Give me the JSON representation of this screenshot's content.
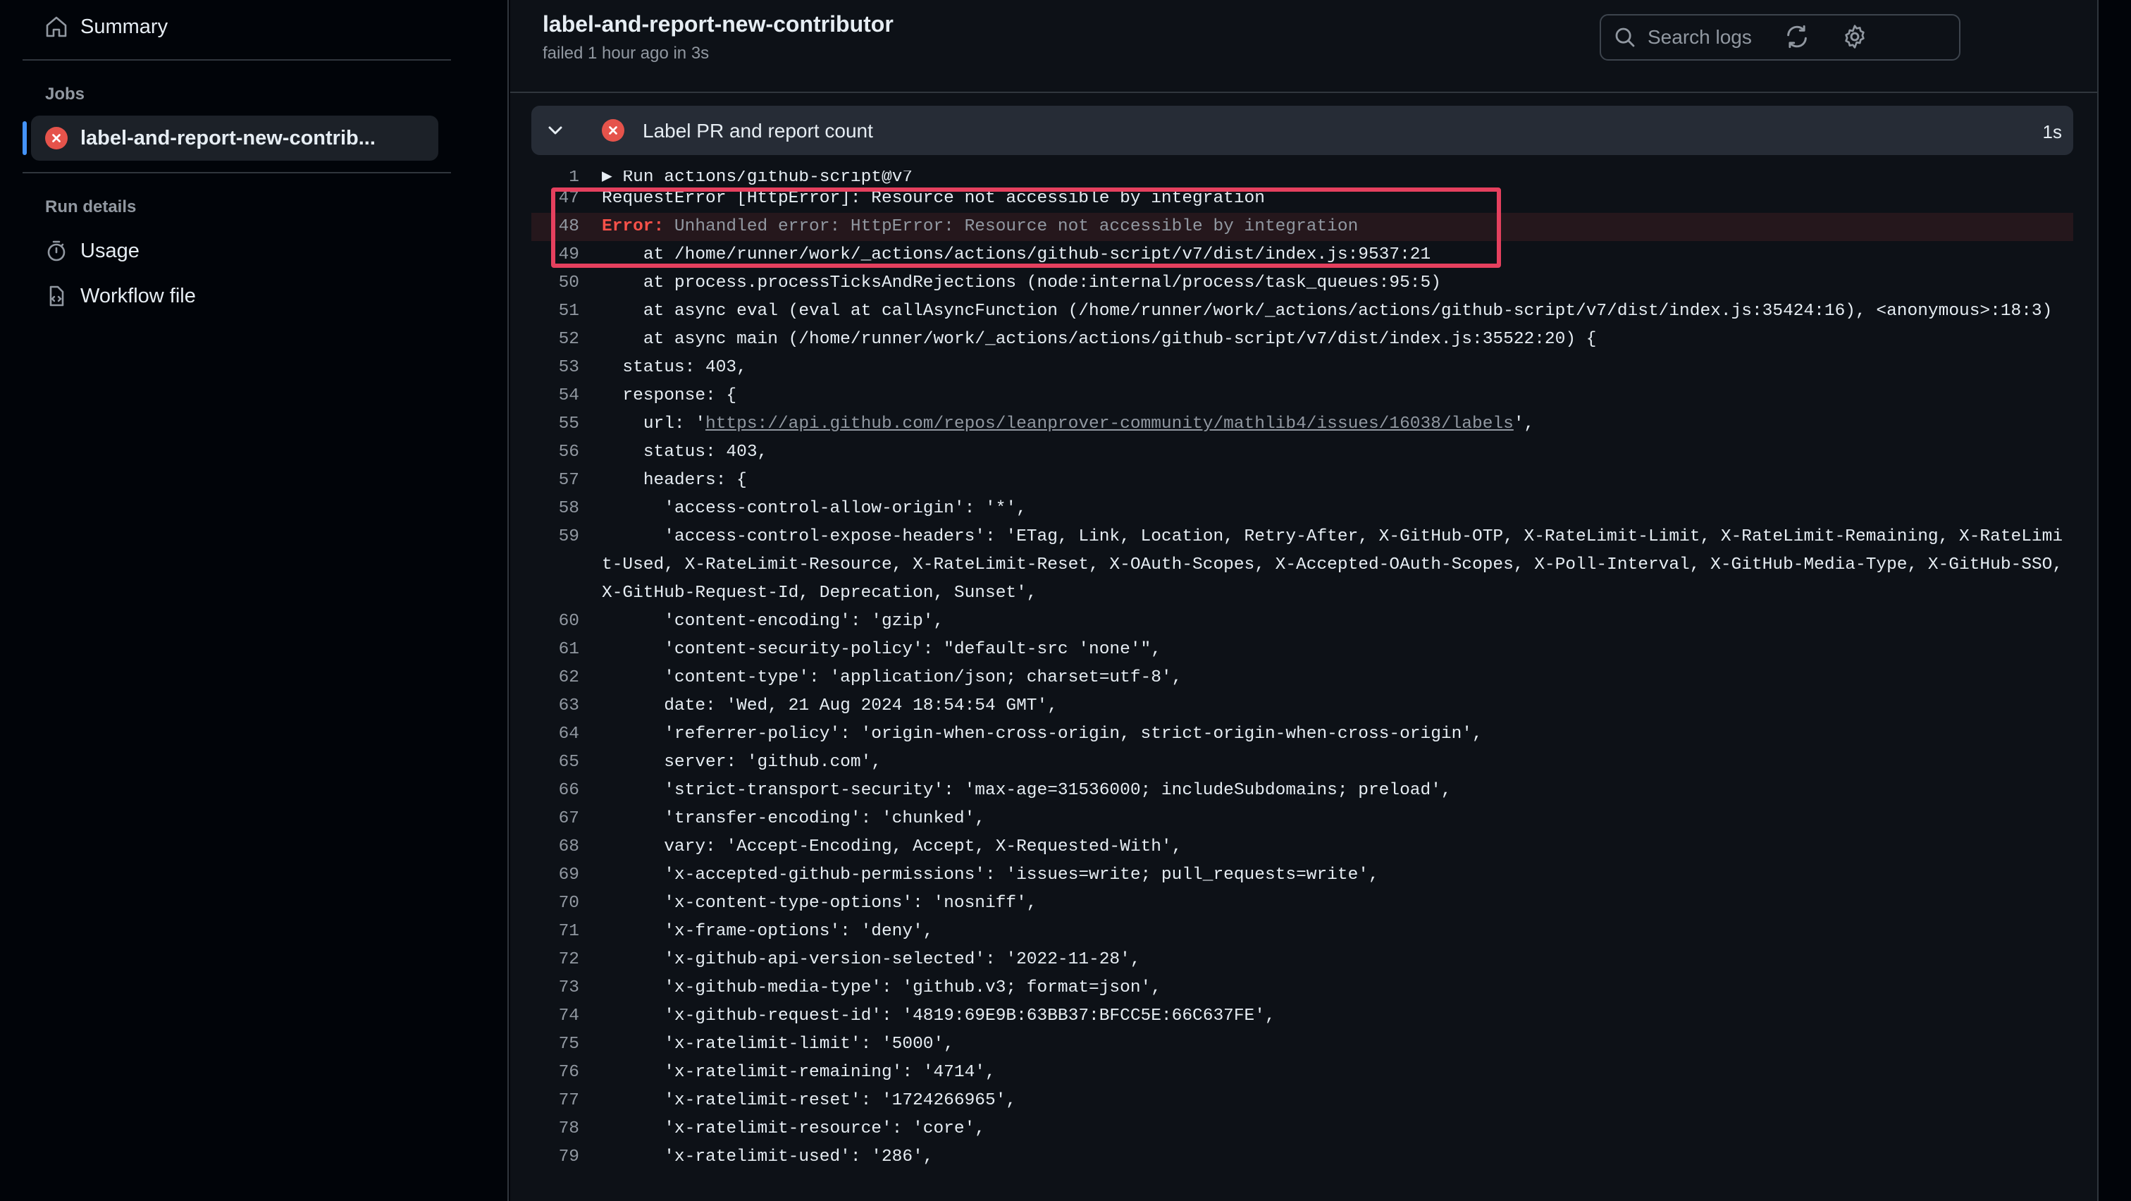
{
  "sidebar": {
    "summary_label": "Summary",
    "jobs_heading": "Jobs",
    "job_label": "label-and-report-new-contrib...",
    "run_details_heading": "Run details",
    "usage_label": "Usage",
    "workflow_file_label": "Workflow file"
  },
  "header": {
    "title": "label-and-report-new-contributor",
    "subtitle": "failed 1 hour ago in 3s",
    "search_placeholder": "Search logs"
  },
  "step": {
    "name": "Label PR and report count",
    "duration": "1s"
  },
  "log": {
    "l1_num": "1",
    "l1_text": "Run actions/github-script@v7",
    "l47_num": "47",
    "l47_text": "RequestError [HttpError]: Resource not accessible by integration",
    "l48_num": "48",
    "l48_kw": "Error:",
    "l48_msg": " Unhandled error: HttpError: Resource not accessible by integration",
    "l49_num": "49",
    "l49_text": "    at /home/runner/work/_actions/actions/github-script/v7/dist/index.js:9537:21",
    "l50_num": "50",
    "l50_text": "    at process.processTicksAndRejections (node:internal/process/task_queues:95:5)",
    "l51_num": "51",
    "l51_text": "    at async eval (eval at callAsyncFunction (/home/runner/work/_actions/actions/github-script/v7/dist/index.js:35424:16), <anonymous>:18:3)",
    "l52_num": "52",
    "l52_text": "    at async main (/home/runner/work/_actions/actions/github-script/v7/dist/index.js:35522:20) {",
    "l53_num": "53",
    "l53_text": "  status: 403,",
    "l54_num": "54",
    "l54_text": "  response: {",
    "l55_num": "55",
    "l55_pre": "    url: '",
    "l55_link": "https://api.github.com/repos/leanprover-community/mathlib4/issues/16038/labels",
    "l55_post": "',",
    "l56_num": "56",
    "l56_text": "    status: 403,",
    "l57_num": "57",
    "l57_text": "    headers: {",
    "l58_num": "58",
    "l58_text": "      'access-control-allow-origin': '*',",
    "l59_num": "59",
    "l59_text": "      'access-control-expose-headers': 'ETag, Link, Location, Retry-After, X-GitHub-OTP, X-RateLimit-Limit, X-RateLimit-Remaining, X-RateLimit-Used, X-RateLimit-Resource, X-RateLimit-Reset, X-OAuth-Scopes, X-Accepted-OAuth-Scopes, X-Poll-Interval, X-GitHub-Media-Type, X-GitHub-SSO, X-GitHub-Request-Id, Deprecation, Sunset',",
    "l60_num": "60",
    "l60_text": "      'content-encoding': 'gzip',",
    "l61_num": "61",
    "l61_text": "      'content-security-policy': \"default-src 'none'\",",
    "l62_num": "62",
    "l62_text": "      'content-type': 'application/json; charset=utf-8',",
    "l63_num": "63",
    "l63_text": "      date: 'Wed, 21 Aug 2024 18:54:54 GMT',",
    "l64_num": "64",
    "l64_text": "      'referrer-policy': 'origin-when-cross-origin, strict-origin-when-cross-origin',",
    "l65_num": "65",
    "l65_text": "      server: 'github.com',",
    "l66_num": "66",
    "l66_text": "      'strict-transport-security': 'max-age=31536000; includeSubdomains; preload',",
    "l67_num": "67",
    "l67_text": "      'transfer-encoding': 'chunked',",
    "l68_num": "68",
    "l68_text": "      vary: 'Accept-Encoding, Accept, X-Requested-With',",
    "l69_num": "69",
    "l69_text": "      'x-accepted-github-permissions': 'issues=write; pull_requests=write',",
    "l70_num": "70",
    "l70_text": "      'x-content-type-options': 'nosniff',",
    "l71_num": "71",
    "l71_text": "      'x-frame-options': 'deny',",
    "l72_num": "72",
    "l72_text": "      'x-github-api-version-selected': '2022-11-28',",
    "l73_num": "73",
    "l73_text": "      'x-github-media-type': 'github.v3; format=json',",
    "l74_num": "74",
    "l74_text": "      'x-github-request-id': '4819:69E9B:63BB37:BFCC5E:66C637FE',",
    "l75_num": "75",
    "l75_text": "      'x-ratelimit-limit': '5000',",
    "l76_num": "76",
    "l76_text": "      'x-ratelimit-remaining': '4714',",
    "l77_num": "77",
    "l77_text": "      'x-ratelimit-reset': '1724266965',",
    "l78_num": "78",
    "l78_text": "      'x-ratelimit-resource': 'core',",
    "l79_num": "79",
    "l79_text": "      'x-ratelimit-used': '286',"
  },
  "colors": {
    "error_red": "#e5534b",
    "highlight_box": "#e5405e",
    "accent_blue": "#4493f8"
  }
}
